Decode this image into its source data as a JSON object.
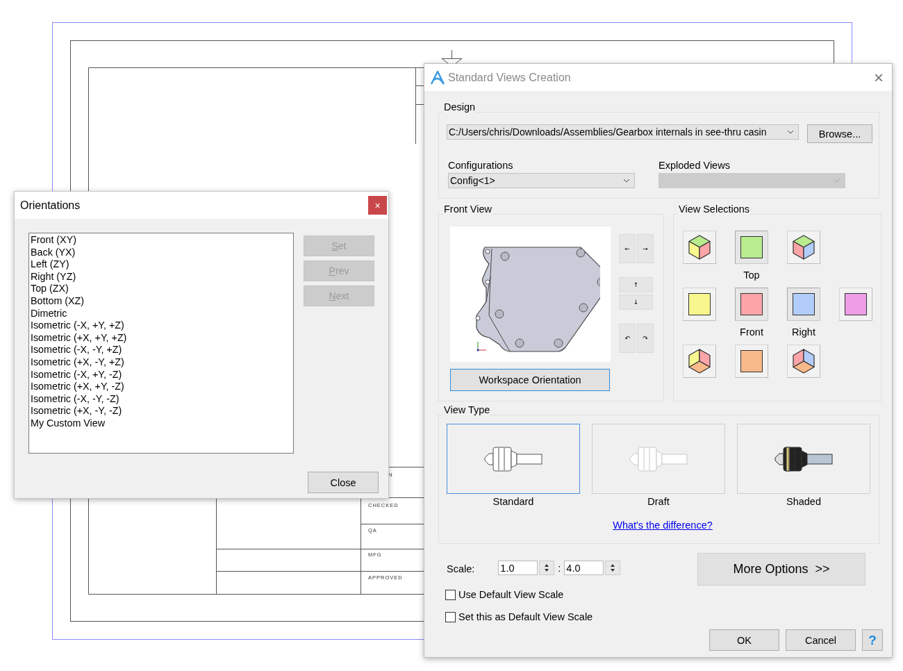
{
  "drawing_sheet": {
    "title_block_labels": [
      "N",
      "CHECKED",
      "QA",
      "MFG",
      "APPROVED"
    ]
  },
  "orientations_dialog": {
    "title": "Orientations",
    "close_glyph": "×",
    "items": [
      {
        "label": "Front (XY)",
        "selected": false
      },
      {
        "label": "Back (YX)",
        "selected": false
      },
      {
        "label": "Left (ZY)",
        "selected": false
      },
      {
        "label": "Right (YZ)",
        "selected": false
      },
      {
        "label": "Top (ZX)",
        "selected": false
      },
      {
        "label": "Bottom (XZ)",
        "selected": false
      },
      {
        "label": "Dimetric",
        "selected": false
      },
      {
        "label": "Isometric (-X, +Y, +Z)",
        "selected": false
      },
      {
        "label": "Isometric (+X, +Y, +Z)",
        "selected": false
      },
      {
        "label": "Isometric (-X, -Y, +Z)",
        "selected": false
      },
      {
        "label": "Isometric (+X, -Y, +Z)",
        "selected": false
      },
      {
        "label": "Isometric (-X, +Y, -Z)",
        "selected": false
      },
      {
        "label": "Isometric (+X, +Y, -Z)",
        "selected": false
      },
      {
        "label": "Isometric (-X, -Y, -Z)",
        "selected": false
      },
      {
        "label": "Isometric (+X, -Y, -Z)",
        "selected": false
      },
      {
        "label": "My Custom View",
        "selected": false
      }
    ],
    "side_buttons": [
      {
        "label": "Set",
        "disabled": true
      },
      {
        "label": "Prev",
        "disabled": true
      },
      {
        "label": "Next",
        "disabled": true
      }
    ],
    "close_button": "Close"
  },
  "views_dialog": {
    "title": "Standard Views Creation",
    "close_glyph": "×",
    "design": {
      "label": "Design",
      "path": "C:/Users/chris/Downloads/Assemblies/Gearbox internals in see-thru casin",
      "browse": "Browse..."
    },
    "configurations": {
      "label": "Configurations",
      "value": "Config<1>",
      "disabled": false
    },
    "exploded_views": {
      "label": "Exploded Views",
      "disabled": true
    },
    "front_view": {
      "label": "Front View",
      "workspace_button": "Workspace Orientation",
      "nav_buttons": [
        {
          "kind": "pair",
          "glyphs": [
            "←",
            "→"
          ]
        },
        {
          "kind": "stack",
          "glyphs": [
            "↑",
            "↓"
          ]
        },
        {
          "kind": "pair",
          "glyphs": [
            "↶",
            "↷"
          ]
        }
      ]
    },
    "view_selections": {
      "label": "View Selections",
      "rows": [
        [
          {
            "kind": "iso_top_left",
            "selected": false
          },
          {
            "kind": "face",
            "color": "#b9ec8f",
            "label": "Top",
            "selected": true
          },
          {
            "kind": "iso_top_right",
            "selected": false
          },
          {
            "kind": "empty"
          }
        ],
        [
          {
            "kind": "face",
            "color": "#f8f68e",
            "selected": false
          },
          {
            "kind": "face",
            "color": "#fba5a9",
            "label": "Front",
            "selected": true
          },
          {
            "kind": "face",
            "color": "#b3cdfb",
            "label": "Right",
            "selected": true
          },
          {
            "kind": "face",
            "color": "#ee9ee6",
            "selected": false
          }
        ],
        [
          {
            "kind": "iso_bottom_left",
            "selected": false
          },
          {
            "kind": "face",
            "color": "#f7b98a",
            "selected": false
          },
          {
            "kind": "iso_bottom_right",
            "selected": false
          },
          {
            "kind": "empty"
          }
        ]
      ]
    },
    "view_type": {
      "label": "View Type",
      "options": [
        {
          "kind": "standard",
          "label": "Standard",
          "selected": true
        },
        {
          "kind": "draft",
          "label": "Draft",
          "selected": false
        },
        {
          "kind": "shaded",
          "label": "Shaded",
          "selected": false
        }
      ],
      "link": "What's the difference?"
    },
    "scale": {
      "label": "Scale:",
      "numerator": "1.0",
      "separator": ":",
      "denominator": "4.0"
    },
    "more_options": "More Options  >>",
    "checkboxes": [
      {
        "label": "Use Default View Scale",
        "checked": false
      },
      {
        "label": "Set this as Default View Scale",
        "checked": false
      }
    ],
    "buttons": [
      "OK",
      "Cancel"
    ],
    "help": "?"
  }
}
